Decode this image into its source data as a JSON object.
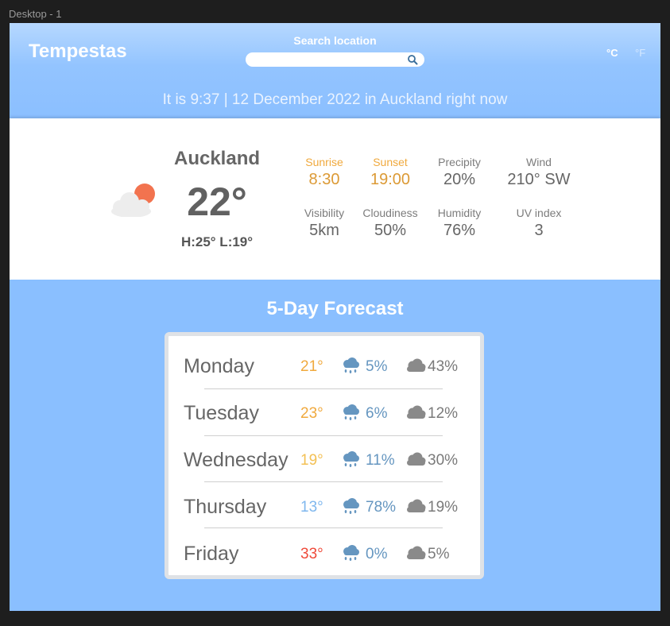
{
  "canvas": {
    "frame_label": "Desktop - 1"
  },
  "header": {
    "brand": "Tempestas",
    "search_label": "Search location",
    "search_value": "",
    "unit_c": "°C",
    "unit_f": "°F",
    "time_line": "It is 9:37 | 12 December 2022 in Auckland right now"
  },
  "current": {
    "icon": "partly-cloudy-icon",
    "city": "Auckland",
    "temp": "22°",
    "hilo": "H:25°  L:19°",
    "stats": [
      {
        "label": "Sunrise",
        "value": "8:30"
      },
      {
        "label": "Sunset",
        "value": "19:00"
      },
      {
        "label": "Precipity",
        "value": "20%"
      },
      {
        "label": "Wind",
        "value": "210° SW"
      },
      {
        "label": "Visibility",
        "value": "5km"
      },
      {
        "label": "Cloudiness",
        "value": "50%"
      },
      {
        "label": "Humidity",
        "value": "76%"
      },
      {
        "label": "UV index",
        "value": "3"
      }
    ]
  },
  "forecast": {
    "title": "5-Day Forecast",
    "rain_icon": "rain-cloud-icon",
    "cloud_icon": "cloud-icon",
    "days": [
      {
        "day": "Monday",
        "temp": "21°",
        "temp_color": "#f0a93d",
        "rain": "5%",
        "cloud": "43%"
      },
      {
        "day": "Tuesday",
        "temp": "23°",
        "temp_color": "#f0a93d",
        "rain": "6%",
        "cloud": "12%"
      },
      {
        "day": "Wednesday",
        "temp": "19°",
        "temp_color": "#f3c054",
        "rain": "11%",
        "cloud": "30%"
      },
      {
        "day": "Thursday",
        "temp": "13°",
        "temp_color": "#7fb7ee",
        "rain": "78%",
        "cloud": "19%"
      },
      {
        "day": "Friday",
        "temp": "33°",
        "temp_color": "#ef4a3a",
        "rain": "0%",
        "cloud": "5%"
      }
    ]
  },
  "colors": {
    "sky": "#8abfff",
    "sun": "#f2734f",
    "rain_icon": "#6596c0",
    "cloud_icon": "#8a8a8a"
  }
}
